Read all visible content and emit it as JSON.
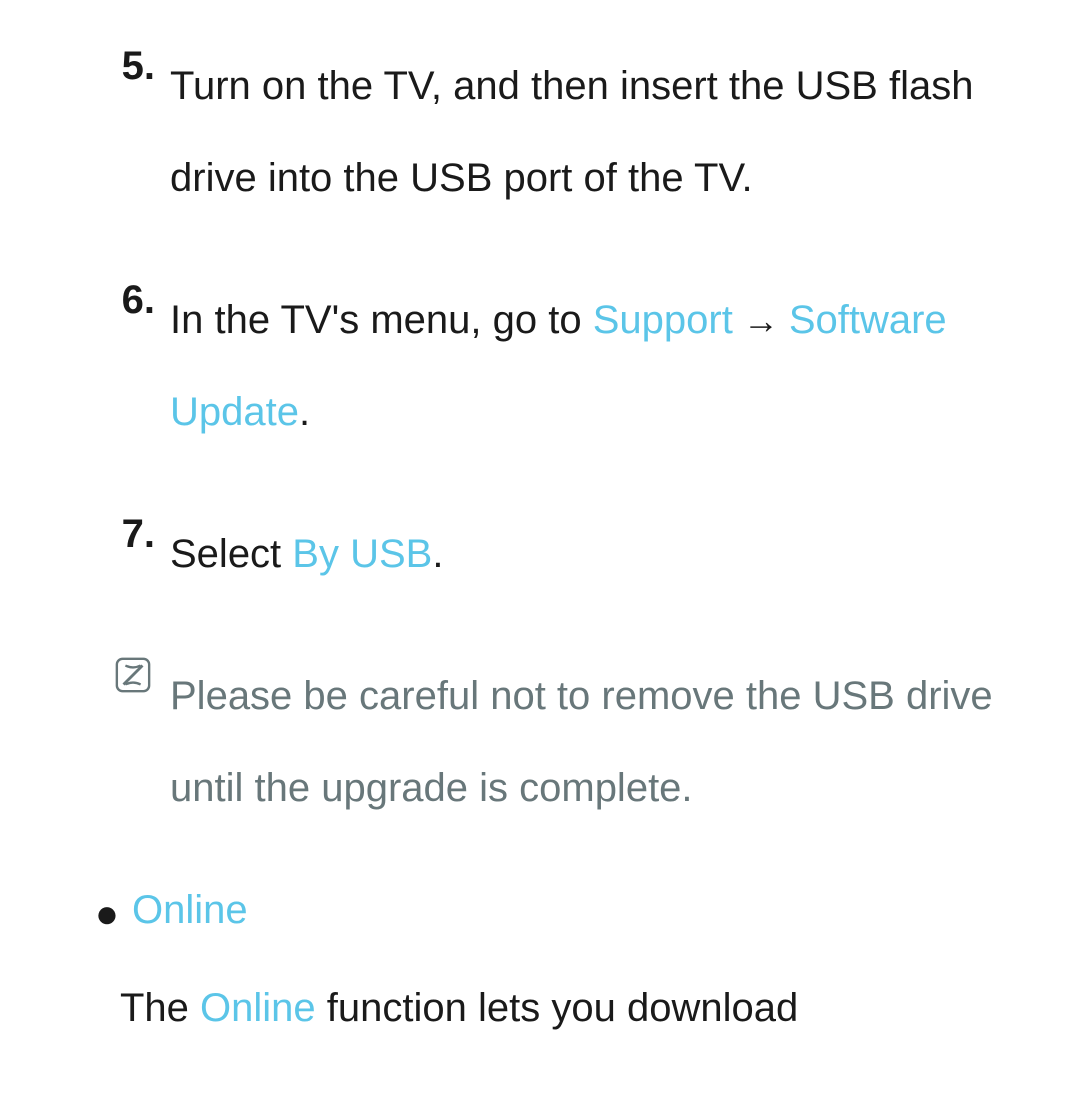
{
  "steps": [
    {
      "number": "5.",
      "text": "Turn on the TV, and then insert the USB flash drive into the USB port of the TV."
    },
    {
      "number": "6.",
      "prefix": "In the TV's menu, go to ",
      "link1": "Support",
      "arrow": " → ",
      "link2": "Software Update",
      "suffix": "."
    },
    {
      "number": "7.",
      "prefix": "Select ",
      "link1": "By USB",
      "suffix": "."
    }
  ],
  "note": {
    "text": "Please be careful not to remove the USB drive until the upgrade is complete."
  },
  "bullet": {
    "label": "Online"
  },
  "para": {
    "prefix": "The ",
    "link": "Online",
    "suffix": " function lets you download"
  }
}
